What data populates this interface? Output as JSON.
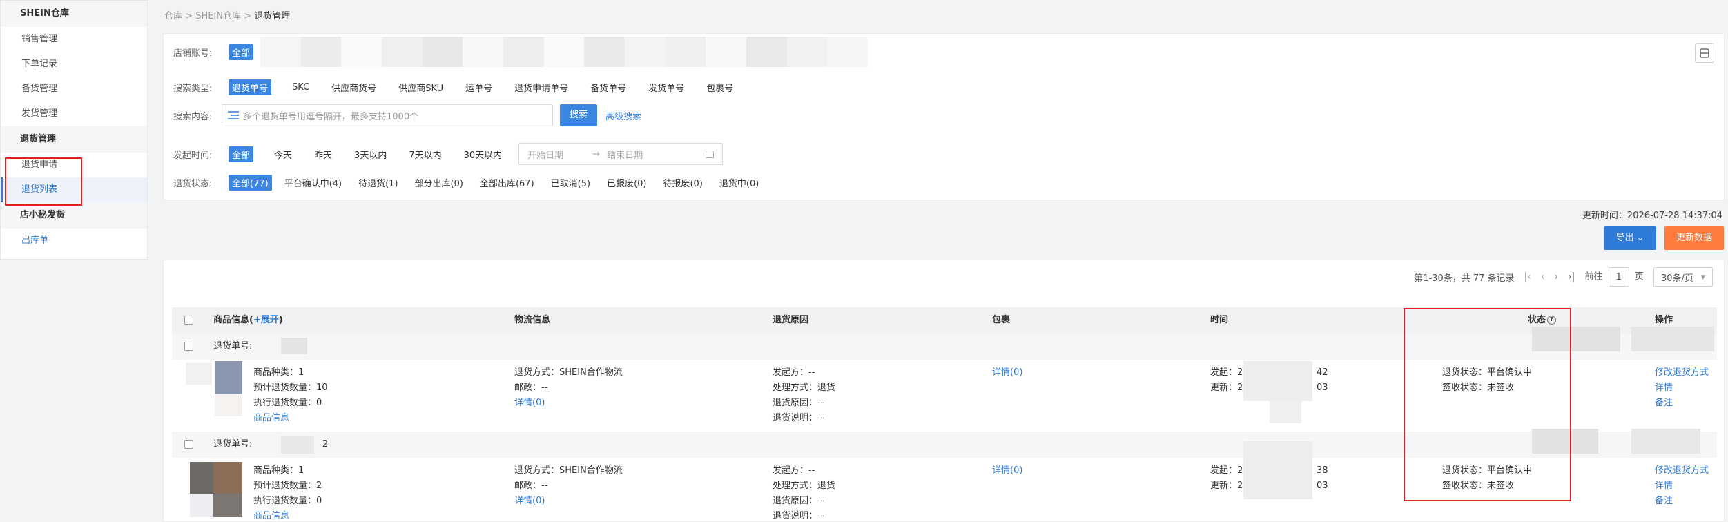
{
  "sidebar": {
    "group1": "SHEIN仓库",
    "items1": [
      "销售管理",
      "下单记录",
      "备货管理",
      "发货管理"
    ],
    "group2": "退货管理",
    "items2": [
      "退货申请",
      "退货列表"
    ],
    "group3": "店小秘发货",
    "items3": [
      "出库单"
    ]
  },
  "breadcrumb": {
    "a": "仓库",
    "sep": ">",
    "b": "SHEIN仓库",
    "c": "退货管理"
  },
  "filter": {
    "shop_label": "店铺账号:",
    "shop_all": "全部",
    "type_label": "搜索类型:",
    "types": [
      "退货单号",
      "SKC",
      "供应商货号",
      "供应商SKU",
      "运单号",
      "退货申请单号",
      "备货单号",
      "发货单号",
      "包裹号"
    ],
    "content_label": "搜索内容:",
    "search_placeholder": "多个退货单号用逗号隔开，最多支持1000个",
    "search_btn": "搜索",
    "advanced": "高级搜索",
    "time_label": "发起时间:",
    "times": [
      "全部",
      "今天",
      "昨天",
      "3天以内",
      "7天以内",
      "30天以内"
    ],
    "date_start": "开始日期",
    "date_sep": "→",
    "date_end": "结束日期",
    "status_label": "退货状态:",
    "statuses": [
      "全部(77)",
      "平台确认中(4)",
      "待退货(1)",
      "部分出库(0)",
      "全部出库(67)",
      "已取消(5)",
      "已报废(0)",
      "待报废(0)",
      "退货中(0)"
    ]
  },
  "toolbar": {
    "update_time": "更新时间：2026-07-28 14:37:04",
    "export": "导出",
    "refresh": "更新数据"
  },
  "pagination": {
    "summary": "第1-30条，共 77 条记录",
    "goto": "前往",
    "page": "1",
    "page_unit": "页",
    "per_page": "30条/页"
  },
  "table": {
    "headers": {
      "product": "商品信息(",
      "expand": "+展开",
      "product_end": ")",
      "logistics": "物流信息",
      "reason": "退货原因",
      "package": "包裹",
      "time": "时间",
      "status": "状态",
      "action": "操作"
    },
    "rows": [
      {
        "order_label": "退货单号:",
        "order_suffix": "",
        "kinds": "商品种类：1",
        "expected": "预计退货数量：10",
        "executed": "执行退货数量：0",
        "product_link": "商品信息",
        "method": "退货方式：SHEIN合作物流",
        "post": "邮政：--",
        "log_detail": "详情(0)",
        "initiator": "发起方：--",
        "handle": "处理方式：退货",
        "reason": "退货原因：--",
        "desc": "退货说明：--",
        "pkg_detail": "详情(0)",
        "start": "发起：2",
        "start_end": "42",
        "update": "更新：2",
        "update_end": "03",
        "ret_status": "退货状态：平台确认中",
        "sign_status": "签收状态：未签收",
        "actions": [
          "修改退货方式",
          "详情",
          "备注"
        ]
      },
      {
        "order_label": "退货单号:",
        "order_suffix": "2",
        "kinds": "商品种类：1",
        "expected": "预计退货数量：2",
        "executed": "执行退货数量：0",
        "product_link": "商品信息",
        "method": "退货方式：SHEIN合作物流",
        "post": "邮政：--",
        "log_detail": "详情(0)",
        "initiator": "发起方：--",
        "handle": "处理方式：退货",
        "reason": "退货原因：--",
        "desc": "退货说明：--",
        "pkg_detail": "详情(0)",
        "start": "发起：2",
        "start_end": "38",
        "update": "更新：2",
        "update_end": "03",
        "ret_status": "退货状态：平台确认中",
        "sign_status": "签收状态：未签收",
        "actions": [
          "修改退货方式",
          "详情",
          "备注"
        ]
      }
    ]
  },
  "colors": {
    "primary": "#2f7bd8",
    "refresh": "#ff7a3d",
    "highlight": "#e02020"
  }
}
